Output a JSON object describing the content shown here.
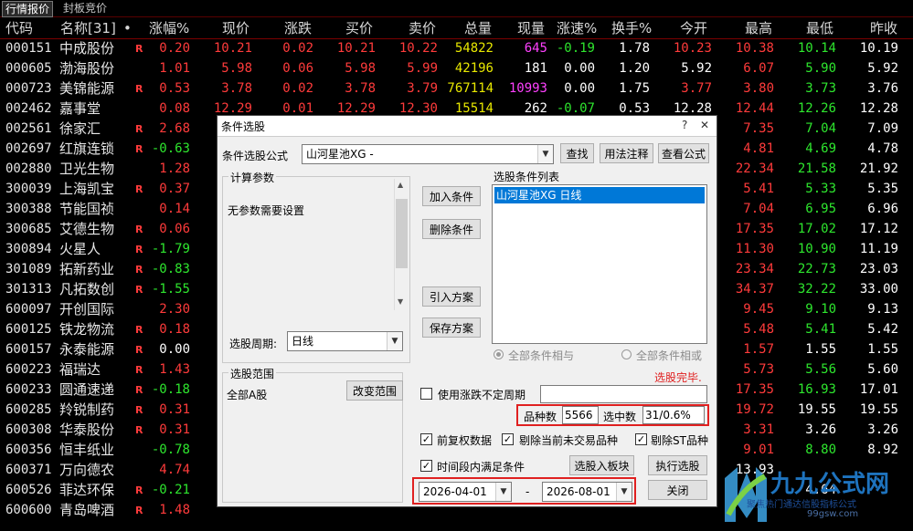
{
  "tabs": [
    {
      "label": "行情报价"
    },
    {
      "label": "封板竞价"
    }
  ],
  "columns": {
    "code": "代码",
    "name": "名称[31]",
    "dot": "•",
    "change_pct": "涨幅%",
    "price": "现价",
    "change": "涨跌",
    "bid": "买价",
    "ask": "卖价",
    "volume": "总量",
    "cur_vol": "现量",
    "speed": "涨速%",
    "turnover": "换手%",
    "open": "今开",
    "high": "最高",
    "low": "最低",
    "prev_close": "昨收"
  },
  "stocks": [
    {
      "code": "000151",
      "name": "中成股份",
      "r": "R",
      "pct": "0.20",
      "price": "10.21",
      "chg": "0.02",
      "bid": "10.21",
      "ask": "10.22",
      "vol": "54822",
      "cur": "645",
      "speed": "-0.19",
      "turn": "1.78",
      "open": "10.23",
      "high": "10.38",
      "low": "10.14",
      "prev": "10.19"
    },
    {
      "code": "000605",
      "name": "渤海股份",
      "r": "",
      "pct": "1.01",
      "price": "5.98",
      "chg": "0.06",
      "bid": "5.98",
      "ask": "5.99",
      "vol": "42196",
      "cur": "181",
      "speed": "0.00",
      "turn": "1.20",
      "open": "5.92",
      "high": "6.07",
      "low": "5.90",
      "prev": "5.92"
    },
    {
      "code": "000723",
      "name": "美锦能源",
      "r": "R",
      "pct": "0.53",
      "price": "3.78",
      "chg": "0.02",
      "bid": "3.78",
      "ask": "3.79",
      "vol": "767114",
      "cur": "10993",
      "speed": "0.00",
      "turn": "1.75",
      "open": "3.77",
      "high": "3.80",
      "low": "3.73",
      "prev": "3.76"
    },
    {
      "code": "002462",
      "name": "嘉事堂",
      "r": "",
      "pct": "0.08",
      "price": "12.29",
      "chg": "0.01",
      "bid": "12.29",
      "ask": "12.30",
      "vol": "15514",
      "cur": "262",
      "speed": "-0.07",
      "turn": "0.53",
      "open": "12.28",
      "high": "12.44",
      "low": "12.26",
      "prev": "12.28"
    },
    {
      "code": "002561",
      "name": "徐家汇",
      "r": "R",
      "pct": "2.68",
      "price": "",
      "chg": "",
      "bid": "",
      "ask": "",
      "vol": "",
      "cur": "",
      "speed": "",
      "turn": "",
      "open": "",
      "high": "7.35",
      "low": "7.04",
      "prev": "7.09"
    },
    {
      "code": "002697",
      "name": "红旗连锁",
      "r": "R",
      "pct": "-0.63",
      "price": "",
      "chg": "",
      "bid": "",
      "ask": "",
      "vol": "",
      "cur": "",
      "speed": "",
      "turn": "",
      "open": "",
      "high": "4.81",
      "low": "4.69",
      "prev": "4.78"
    },
    {
      "code": "002880",
      "name": "卫光生物",
      "r": "",
      "pct": "1.28",
      "price": "",
      "chg": "",
      "bid": "",
      "ask": "",
      "vol": "",
      "cur": "",
      "speed": "",
      "turn": "",
      "open": "",
      "high": "22.34",
      "low": "21.58",
      "prev": "21.92"
    },
    {
      "code": "300039",
      "name": "上海凯宝",
      "r": "R",
      "pct": "0.37",
      "price": "",
      "chg": "",
      "bid": "",
      "ask": "",
      "vol": "",
      "cur": "",
      "speed": "",
      "turn": "",
      "open": "",
      "high": "5.41",
      "low": "5.33",
      "prev": "5.35"
    },
    {
      "code": "300388",
      "name": "节能国祯",
      "r": "",
      "pct": "0.14",
      "price": "",
      "chg": "",
      "bid": "",
      "ask": "",
      "vol": "",
      "cur": "",
      "speed": "",
      "turn": "",
      "open": "",
      "high": "7.04",
      "low": "6.95",
      "prev": "6.96"
    },
    {
      "code": "300685",
      "name": "艾德生物",
      "r": "R",
      "pct": "0.06",
      "price": "",
      "chg": "",
      "bid": "",
      "ask": "",
      "vol": "",
      "cur": "",
      "speed": "",
      "turn": "",
      "open": "",
      "high": "17.35",
      "low": "17.02",
      "prev": "17.12"
    },
    {
      "code": "300894",
      "name": "火星人",
      "r": "R",
      "pct": "-1.79",
      "price": "",
      "chg": "",
      "bid": "",
      "ask": "",
      "vol": "",
      "cur": "",
      "speed": "",
      "turn": "",
      "open": "",
      "high": "11.30",
      "low": "10.90",
      "prev": "11.19"
    },
    {
      "code": "301089",
      "name": "拓新药业",
      "r": "R",
      "pct": "-0.83",
      "price": "",
      "chg": "",
      "bid": "",
      "ask": "",
      "vol": "",
      "cur": "",
      "speed": "",
      "turn": "",
      "open": "",
      "high": "23.34",
      "low": "22.73",
      "prev": "23.03"
    },
    {
      "code": "301313",
      "name": "凡拓数创",
      "r": "R",
      "pct": "-1.55",
      "price": "",
      "chg": "",
      "bid": "",
      "ask": "",
      "vol": "",
      "cur": "",
      "speed": "",
      "turn": "",
      "open": "",
      "high": "34.37",
      "low": "32.22",
      "prev": "33.00"
    },
    {
      "code": "600097",
      "name": "开创国际",
      "r": "",
      "pct": "2.30",
      "price": "",
      "chg": "",
      "bid": "",
      "ask": "",
      "vol": "",
      "cur": "",
      "speed": "",
      "turn": "",
      "open": "",
      "high": "9.45",
      "low": "9.10",
      "prev": "9.13"
    },
    {
      "code": "600125",
      "name": "铁龙物流",
      "r": "R",
      "pct": "0.18",
      "price": "",
      "chg": "",
      "bid": "",
      "ask": "",
      "vol": "",
      "cur": "",
      "speed": "",
      "turn": "",
      "open": "",
      "high": "5.48",
      "low": "5.41",
      "prev": "5.42"
    },
    {
      "code": "600157",
      "name": "永泰能源",
      "r": "R",
      "pct": "0.00",
      "price": "",
      "chg": "",
      "bid": "",
      "ask": "",
      "vol": "",
      "cur": "",
      "speed": "",
      "turn": "",
      "open": "",
      "high": "1.57",
      "low": "1.55",
      "prev": "1.55"
    },
    {
      "code": "600223",
      "name": "福瑞达",
      "r": "R",
      "pct": "1.43",
      "price": "",
      "chg": "",
      "bid": "",
      "ask": "",
      "vol": "",
      "cur": "",
      "speed": "",
      "turn": "",
      "open": "",
      "high": "5.73",
      "low": "5.56",
      "prev": "5.60"
    },
    {
      "code": "600233",
      "name": "圆通速递",
      "r": "R",
      "pct": "-0.18",
      "price": "",
      "chg": "",
      "bid": "",
      "ask": "",
      "vol": "",
      "cur": "",
      "speed": "",
      "turn": "",
      "open": "",
      "high": "17.35",
      "low": "16.93",
      "prev": "17.01"
    },
    {
      "code": "600285",
      "name": "羚锐制药",
      "r": "R",
      "pct": "0.31",
      "price": "",
      "chg": "",
      "bid": "",
      "ask": "",
      "vol": "",
      "cur": "",
      "speed": "",
      "turn": "",
      "open": "",
      "high": "19.72",
      "low": "19.55",
      "prev": "19.55"
    },
    {
      "code": "600308",
      "name": "华泰股份",
      "r": "R",
      "pct": "0.31",
      "price": "",
      "chg": "",
      "bid": "",
      "ask": "",
      "vol": "",
      "cur": "",
      "speed": "",
      "turn": "",
      "open": "",
      "high": "3.31",
      "low": "3.26",
      "prev": "3.26"
    },
    {
      "code": "600356",
      "name": "恒丰纸业",
      "r": "",
      "pct": "-0.78",
      "price": "",
      "chg": "",
      "bid": "",
      "ask": "",
      "vol": "",
      "cur": "",
      "speed": "",
      "turn": "",
      "open": "",
      "high": "9.01",
      "low": "8.80",
      "prev": "8.92"
    },
    {
      "code": "600371",
      "name": "万向德农",
      "r": "",
      "pct": "4.74",
      "price": "",
      "chg": "",
      "bid": "",
      "ask": "",
      "vol": "",
      "cur": "",
      "speed": "",
      "turn": "",
      "open": "",
      "high": "13.93",
      "low": "",
      "prev": ""
    },
    {
      "code": "600526",
      "name": "菲达环保",
      "r": "R",
      "pct": "-0.21",
      "price": "",
      "chg": "",
      "bid": "",
      "ask": "",
      "vol": "",
      "cur": "",
      "speed": "",
      "turn": "",
      "open": "",
      "high": "",
      "low": "4.64",
      "prev": ""
    },
    {
      "code": "600600",
      "name": "青岛啤酒",
      "r": "R",
      "pct": "1.48",
      "price": "",
      "chg": "",
      "bid": "",
      "ask": "",
      "vol": "",
      "cur": "",
      "speed": "",
      "turn": "",
      "open": "",
      "high": "",
      "low": "",
      "prev": ""
    }
  ],
  "dialog": {
    "title": "条件选股",
    "formula_label": "条件选股公式",
    "formula_value": "山河星池XG  -",
    "btn_find": "查找",
    "btn_usage": "用法注释",
    "btn_view": "查看公式",
    "params_group": "计算参数",
    "params_text": "无参数需要设置",
    "period_label": "选股周期:",
    "period_value": "日线",
    "btn_add": "加入条件",
    "btn_delete": "删除条件",
    "btn_import": "引入方案",
    "btn_save": "保存方案",
    "cond_list_label": "选股条件列表",
    "cond_item": "山河星池XG  日线",
    "radio_and": "全部条件相与",
    "radio_or": "全部条件相或",
    "status": "选股完毕.",
    "range_group": "选股范围",
    "range_value": "全部A股",
    "btn_change_range": "改变范围",
    "chk_irregular": "使用涨跌不定周期",
    "count_label": "品种数",
    "count_value": "5566",
    "selected_label": "选中数",
    "selected_value": "31/0.6%",
    "chk_adjusted": "前复权数据",
    "chk_remove_inactive": "剔除当前未交易品种",
    "chk_remove_st": "剔除ST品种",
    "chk_time_range": "时间段内满足条件",
    "btn_to_sector": "选股入板块",
    "btn_execute": "执行选股",
    "date_from": "2026-04-01",
    "date_sep": "-",
    "date_to": "2026-08-01",
    "btn_close": "关闭",
    "close_x": "✕",
    "help_q": "?"
  },
  "watermark": {
    "brand": "九九公式网",
    "slogan": "聚焦热门通达信股指标公式",
    "url": "99gsw.com"
  },
  "colors": {
    "up": "#ff3b3b",
    "down": "#2ee62e",
    "flat": "#ffffff",
    "volume": "#e8e800",
    "cur_volume_hot": "#ff40ff",
    "highlight_box": "#e02020",
    "selection": "#0078d7"
  }
}
